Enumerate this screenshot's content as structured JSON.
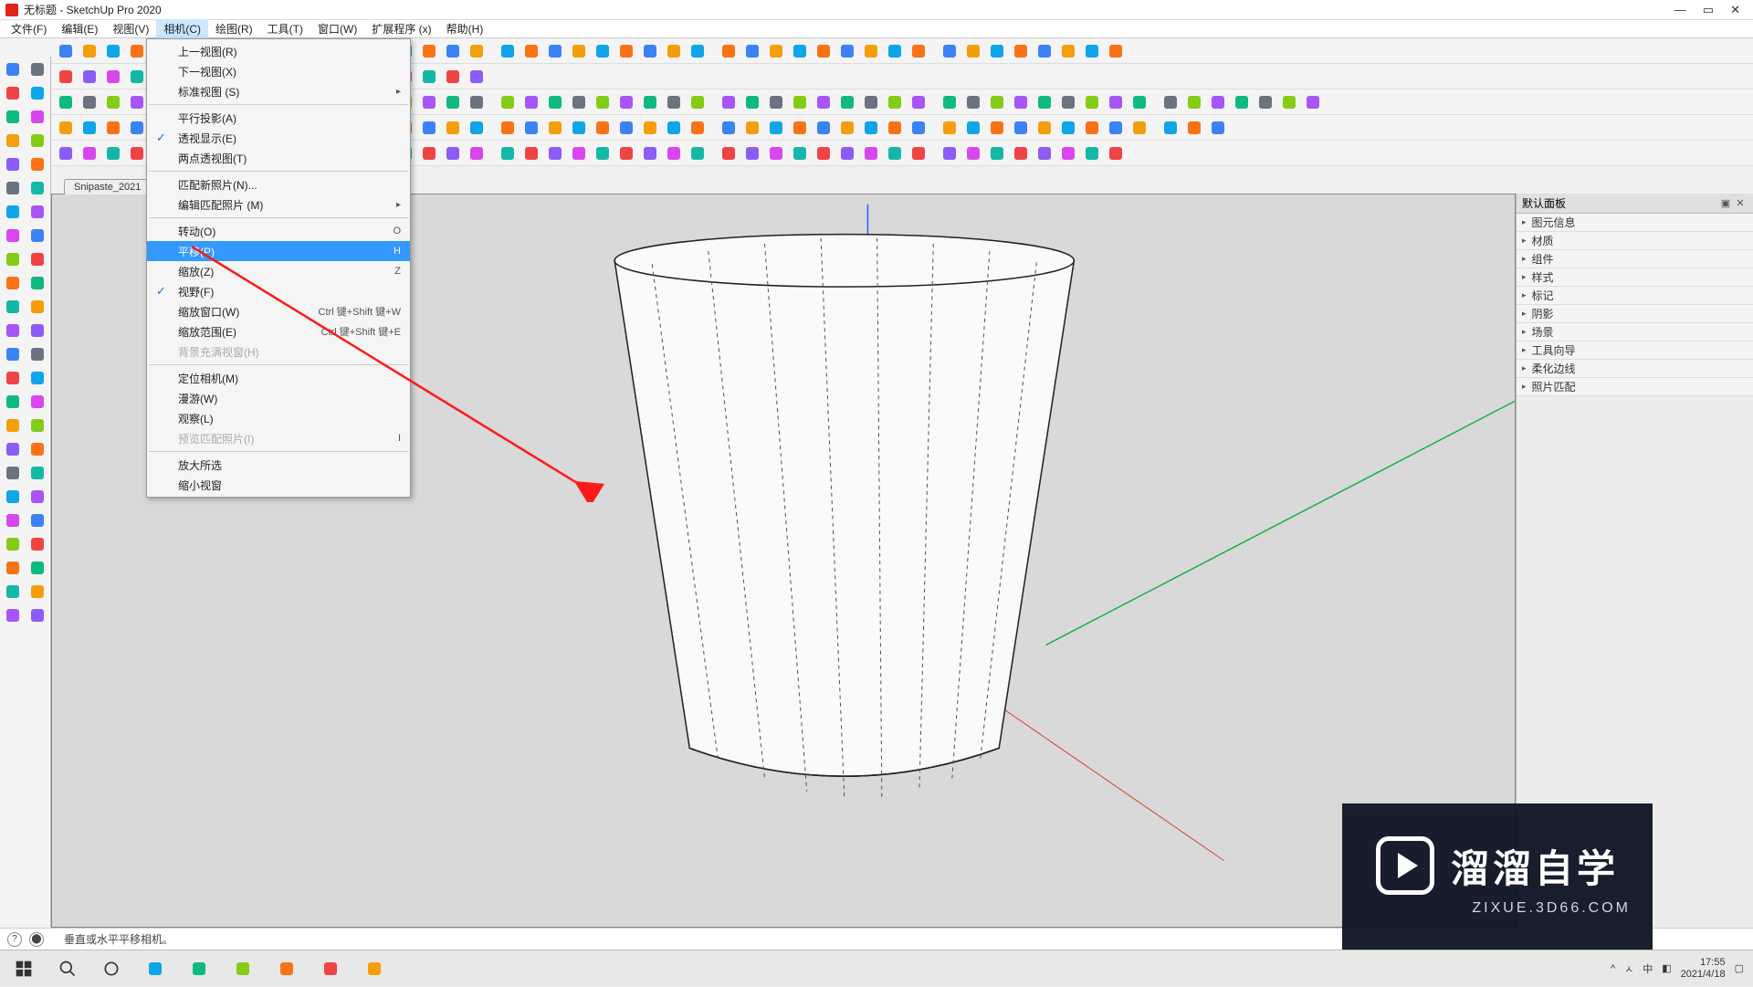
{
  "window": {
    "title": "无标题 - SketchUp Pro 2020",
    "min": "—",
    "max": "▭",
    "close": "✕"
  },
  "menubar": [
    "文件(F)",
    "编辑(E)",
    "视图(V)",
    "相机(C)",
    "绘图(R)",
    "工具(T)",
    "窗口(W)",
    "扩展程序 (x)",
    "帮助(H)"
  ],
  "active_menu_index": 3,
  "scene_tab": "Snipaste_2021",
  "dropdown": {
    "groups": [
      [
        {
          "label": "上一视图(R)"
        },
        {
          "label": "下一视图(X)"
        },
        {
          "label": "标准视图 (S)",
          "submenu": true
        }
      ],
      [
        {
          "label": "平行投影(A)"
        },
        {
          "label": "透视显示(E)",
          "checked": true
        },
        {
          "label": "两点透视图(T)"
        }
      ],
      [
        {
          "label": "匹配新照片(N)..."
        },
        {
          "label": "编辑匹配照片 (M)",
          "submenu": true
        }
      ],
      [
        {
          "label": "转动(O)",
          "shortcut": "O"
        },
        {
          "label": "平移(P)",
          "shortcut": "H",
          "highlight": true
        },
        {
          "label": "缩放(Z)",
          "shortcut": "Z"
        },
        {
          "label": "视野(F)",
          "checked": true
        },
        {
          "label": "缩放窗口(W)",
          "shortcut": "Ctrl 键+Shift 键+W"
        },
        {
          "label": "缩放范围(E)",
          "shortcut": "Ctrl 键+Shift 键+E"
        },
        {
          "label": "背景充满视窗(H)",
          "disabled": true
        }
      ],
      [
        {
          "label": "定位相机(M)"
        },
        {
          "label": "漫游(W)"
        },
        {
          "label": "观察(L)"
        },
        {
          "label": "预览匹配照片(I)",
          "shortcut": "I",
          "disabled": true
        }
      ],
      [
        {
          "label": "放大所选"
        },
        {
          "label": "缩小视窗"
        }
      ]
    ]
  },
  "right_panel": {
    "title": "默认面板",
    "sections": [
      "图元信息",
      "材质",
      "组件",
      "样式",
      "标记",
      "阴影",
      "场景",
      "工具向导",
      "柔化边线",
      "照片匹配"
    ]
  },
  "statusbar": {
    "text": "垂直或水平平移相机。"
  },
  "watermark": {
    "brand": "溜溜自学",
    "url": "ZIXUE.3D66.COM"
  },
  "taskbar": {
    "time": "17:55",
    "date": "2021/4/18",
    "tray": [
      "^",
      "ㅅ",
      "中",
      "◧"
    ]
  }
}
